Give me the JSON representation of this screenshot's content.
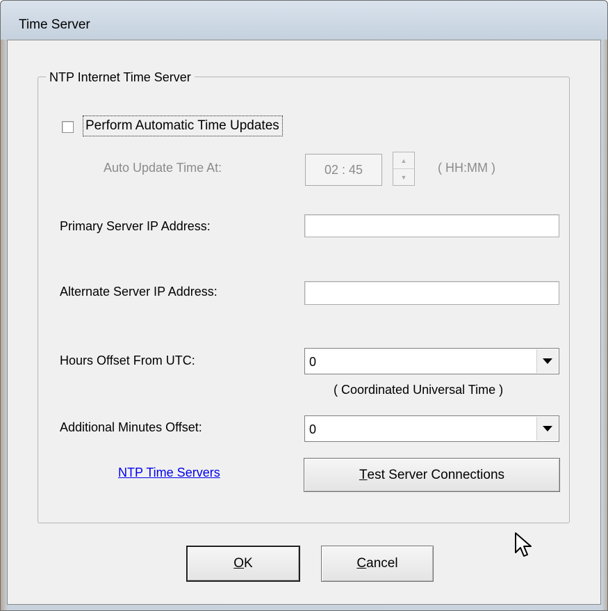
{
  "window": {
    "title": "Time Server"
  },
  "group": {
    "title": "NTP Internet Time Server"
  },
  "auto_update": {
    "checkbox_label": "Perform Automatic Time Updates",
    "checked": false,
    "time_label": "Auto Update Time At:",
    "time_value": "02 : 45",
    "time_format": "( HH:MM )"
  },
  "primary_server": {
    "label": "Primary Server IP Address:",
    "value": ""
  },
  "alternate_server": {
    "label": "Alternate Server IP Address:",
    "value": ""
  },
  "hours_offset": {
    "label": "Hours Offset From UTC:",
    "selected": "0",
    "note": "( Coordinated Universal Time )"
  },
  "minutes_offset": {
    "label": "Additional Minutes Offset:",
    "selected": "0"
  },
  "link": {
    "text": "NTP Time Servers"
  },
  "test_button": {
    "mnemonic": "T",
    "rest": "est Server Connections"
  },
  "ok_button": {
    "mnemonic": "O",
    "rest": "K"
  },
  "cancel_button": {
    "mnemonic": "C",
    "rest": "ancel"
  },
  "colors": {
    "link": "#0000ee",
    "disabled_text": "#8b8b8b",
    "dialog_bg": "#f0f0f0"
  }
}
